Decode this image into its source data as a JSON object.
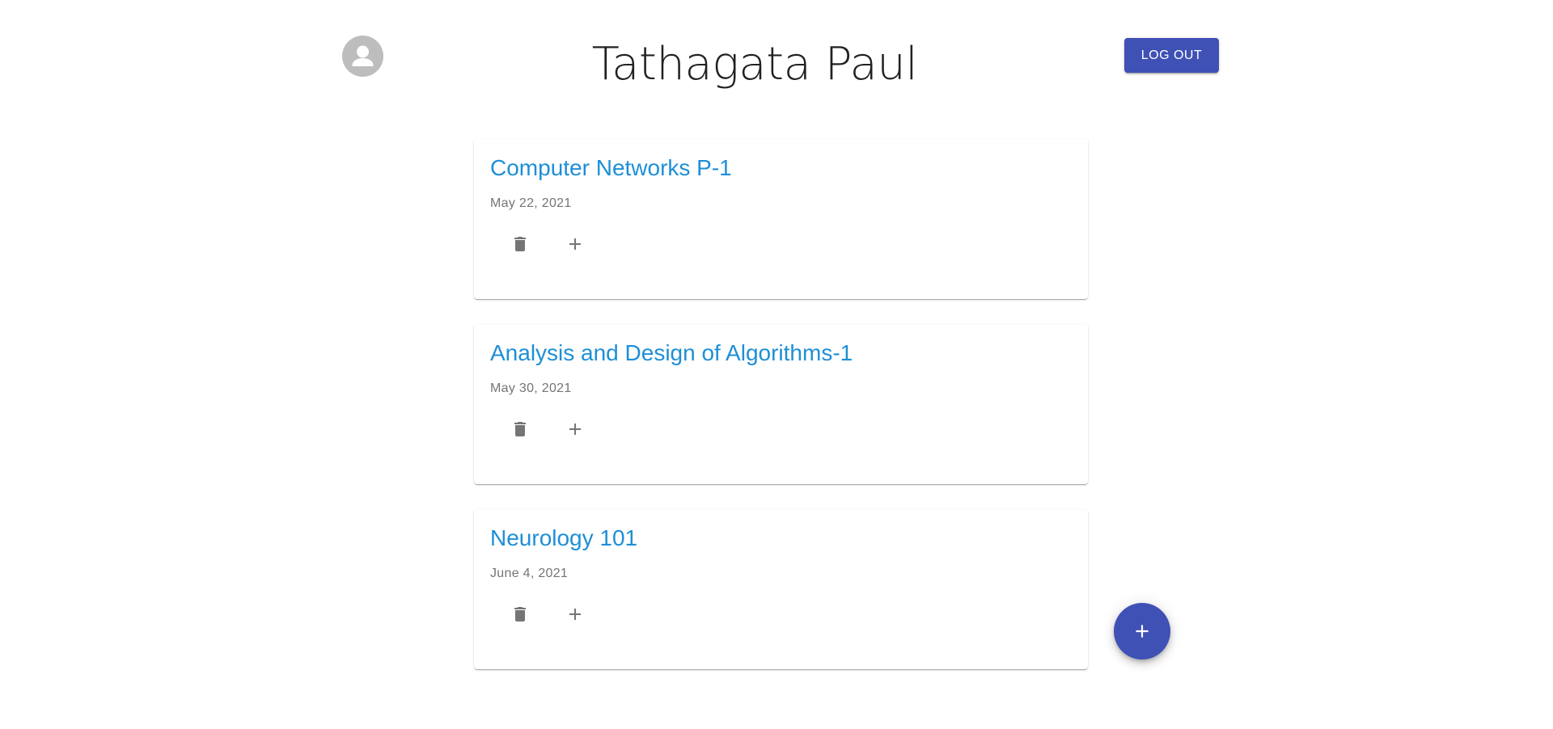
{
  "header": {
    "user_name": "Tathagata Paul",
    "logout_label": "LOG OUT",
    "avatar_icon": "person-icon"
  },
  "colors": {
    "primary": "#3f51b5",
    "title_link": "#1e8fd6",
    "icon_grey": "#757575",
    "avatar_bg": "#bdbdbd"
  },
  "notebooks": [
    {
      "title": "Computer Networks P-1",
      "date": "May 22, 2021",
      "actions": [
        "trash-icon",
        "plus-icon"
      ]
    },
    {
      "title": "Analysis and Design of Algorithms-1",
      "date": "May 30, 2021",
      "actions": [
        "trash-icon",
        "plus-icon"
      ]
    },
    {
      "title": "Neurology 101",
      "date": "June 4, 2021",
      "actions": [
        "trash-icon",
        "plus-icon"
      ]
    }
  ],
  "fab": {
    "icon": "plus-icon"
  }
}
